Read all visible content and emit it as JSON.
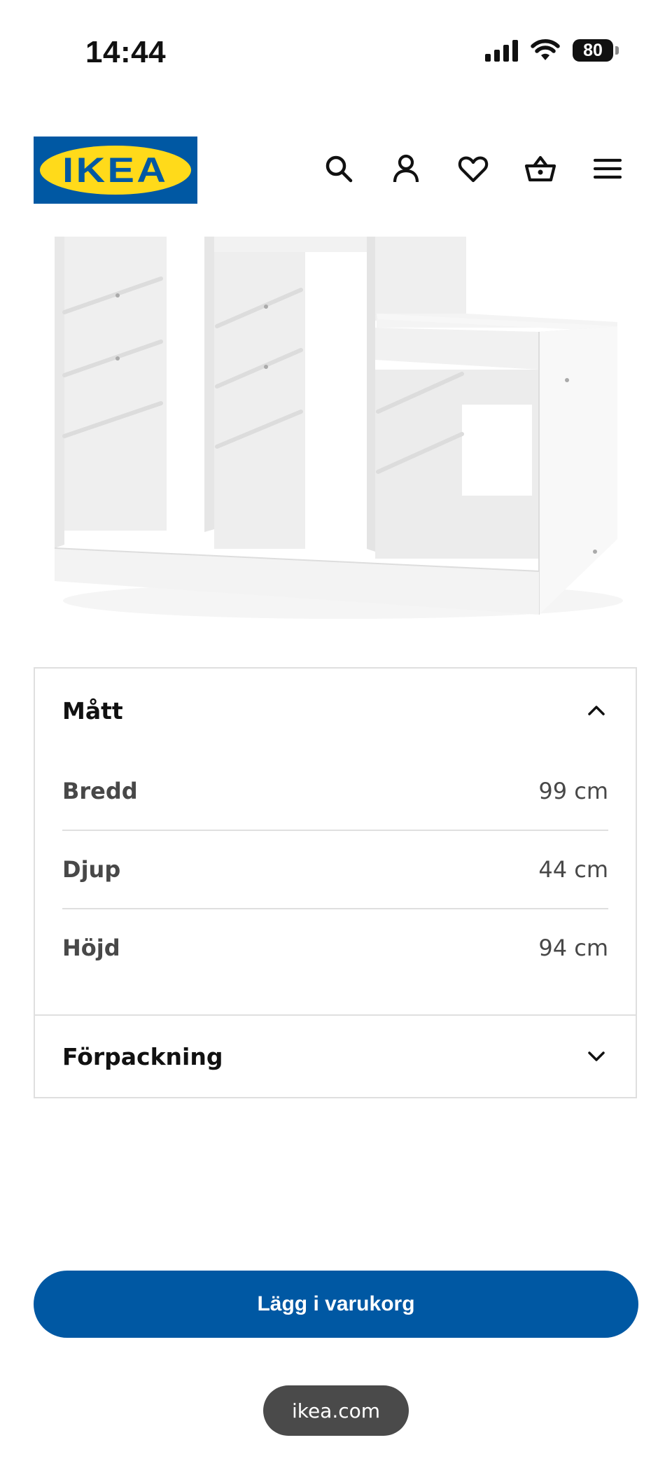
{
  "status_bar": {
    "time": "14:44",
    "battery": "80",
    "icons": [
      "signal-icon",
      "wifi-icon",
      "battery-icon"
    ]
  },
  "header": {
    "logo_text": "IKEA",
    "icons": [
      "search-icon",
      "account-icon",
      "heart-icon",
      "basket-icon",
      "menu-icon"
    ]
  },
  "colors": {
    "brand_blue": "#0058a3",
    "brand_yellow": "#ffda1a",
    "text_dark": "#111111",
    "text_gray": "#484848",
    "divider": "#dfdfdf"
  },
  "dimensions": {
    "title": "Mått",
    "expanded": true,
    "rows": [
      {
        "label": "Bredd",
        "value": "99 cm"
      },
      {
        "label": "Djup",
        "value": "44 cm"
      },
      {
        "label": "Höjd",
        "value": "94 cm"
      }
    ]
  },
  "packaging": {
    "title": "Förpackning",
    "expanded": false
  },
  "cart_button": {
    "label": "Lägg i varukorg"
  },
  "browser": {
    "url": "ikea.com"
  }
}
